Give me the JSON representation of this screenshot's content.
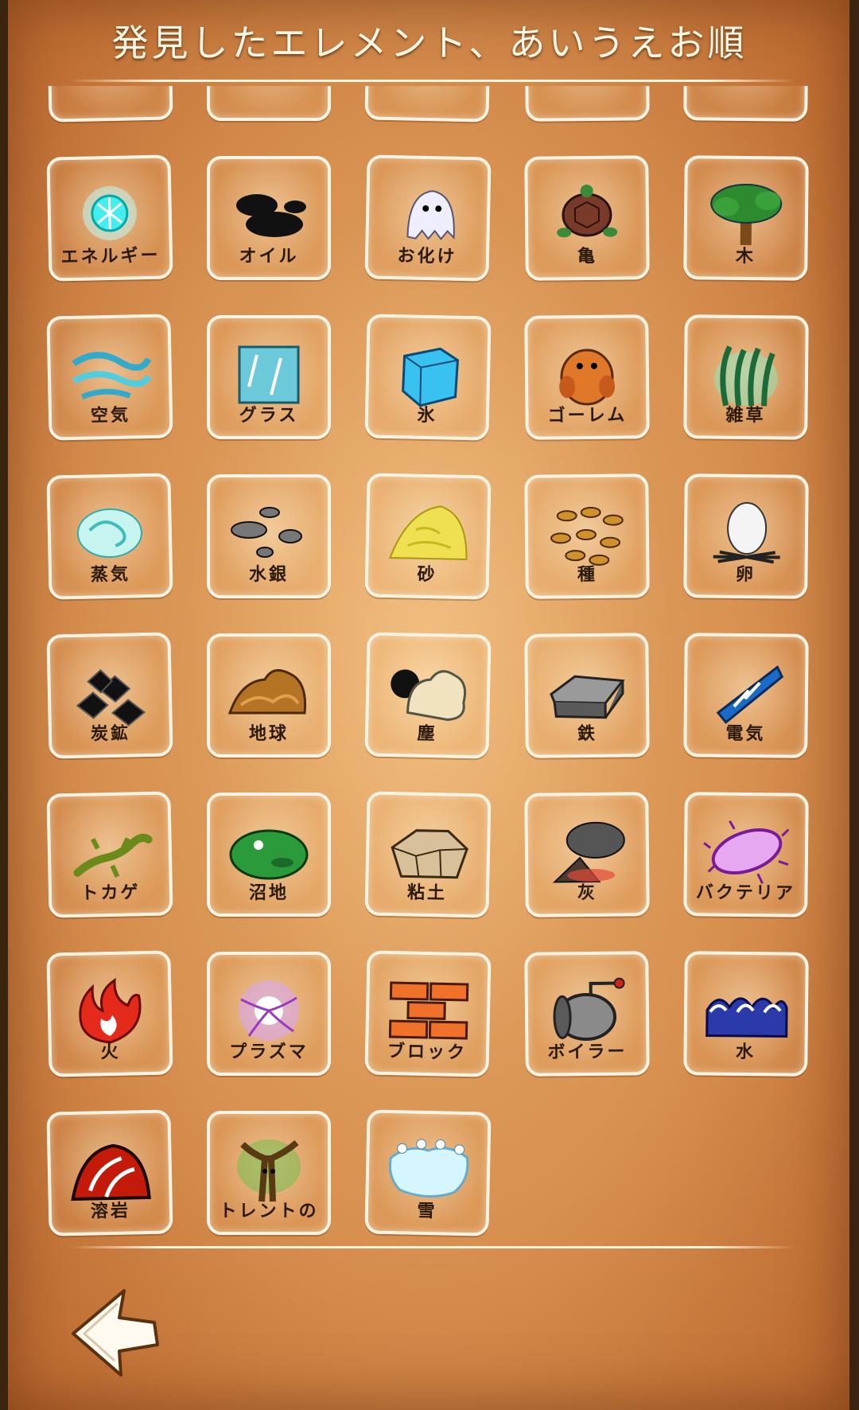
{
  "header": {
    "title": "発見したエレメント、あいうえお順"
  },
  "elements": [
    {
      "label": "",
      "icon": "partial-icon"
    },
    {
      "label": "",
      "icon": "partial-icon"
    },
    {
      "label": "",
      "icon": "partial-icon"
    },
    {
      "label": "",
      "icon": "partial-icon"
    },
    {
      "label": "",
      "icon": "partial-icon"
    },
    {
      "label": "エネルギー",
      "icon": "energy-icon"
    },
    {
      "label": "オイル",
      "icon": "oil-icon"
    },
    {
      "label": "お化け",
      "icon": "ghost-icon"
    },
    {
      "label": "亀",
      "icon": "turtle-icon"
    },
    {
      "label": "木",
      "icon": "tree-icon"
    },
    {
      "label": "空気",
      "icon": "air-icon"
    },
    {
      "label": "グラス",
      "icon": "glass-icon"
    },
    {
      "label": "氷",
      "icon": "ice-icon"
    },
    {
      "label": "ゴーレム",
      "icon": "golem-icon"
    },
    {
      "label": "雑草",
      "icon": "weed-icon"
    },
    {
      "label": "蒸気",
      "icon": "steam-icon"
    },
    {
      "label": "水銀",
      "icon": "mercury-icon"
    },
    {
      "label": "砂",
      "icon": "sand-icon"
    },
    {
      "label": "種",
      "icon": "seeds-icon"
    },
    {
      "label": "卵",
      "icon": "egg-icon"
    },
    {
      "label": "炭鉱",
      "icon": "coal-icon"
    },
    {
      "label": "地球",
      "icon": "earth-icon"
    },
    {
      "label": "塵",
      "icon": "dust-icon"
    },
    {
      "label": "鉄",
      "icon": "iron-icon"
    },
    {
      "label": "電気",
      "icon": "electricity-icon"
    },
    {
      "label": "トカゲ",
      "icon": "lizard-icon"
    },
    {
      "label": "沼地",
      "icon": "swamp-icon"
    },
    {
      "label": "粘土",
      "icon": "clay-icon"
    },
    {
      "label": "灰",
      "icon": "ash-icon"
    },
    {
      "label": "バクテリア",
      "icon": "bacteria-icon"
    },
    {
      "label": "火",
      "icon": "fire-icon"
    },
    {
      "label": "プラズマ",
      "icon": "plasma-icon"
    },
    {
      "label": "ブロック",
      "icon": "brick-icon"
    },
    {
      "label": "ボイラー",
      "icon": "boiler-icon"
    },
    {
      "label": "水",
      "icon": "water-icon"
    },
    {
      "label": "溶岩",
      "icon": "lava-icon"
    },
    {
      "label": "トレントの",
      "icon": "treant-icon"
    },
    {
      "label": "雪",
      "icon": "snow-icon"
    }
  ],
  "footer": {
    "back_icon": "back-arrow-icon"
  },
  "colors": {
    "parchment": "#d68d4d",
    "tile_border": "#fbf3e4",
    "label_text": "#2b1a0c",
    "title_text": "#fff7e6"
  }
}
